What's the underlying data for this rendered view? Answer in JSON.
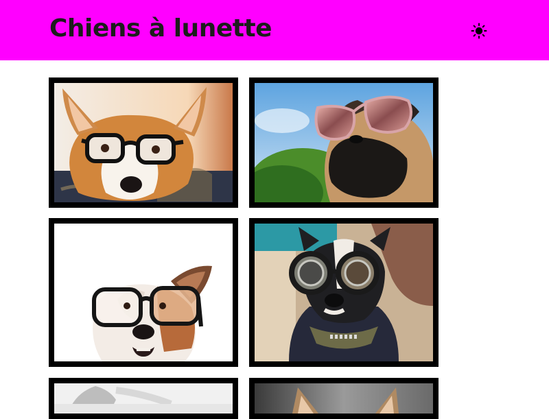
{
  "header": {
    "title": "Chiens à lunette",
    "background_color": "#ff00ff",
    "theme_toggle_icon": "sun-icon"
  },
  "gallery": {
    "frame_color": "#000000",
    "items": [
      {
        "subject": "corgi-with-black-glasses"
      },
      {
        "subject": "pug-with-pink-sunglasses"
      },
      {
        "subject": "terrier-with-black-glasses"
      },
      {
        "subject": "boston-terrier-with-round-goggles"
      },
      {
        "subject": "blurred-dog-photo"
      },
      {
        "subject": "dog-with-pointed-ears"
      }
    ]
  }
}
